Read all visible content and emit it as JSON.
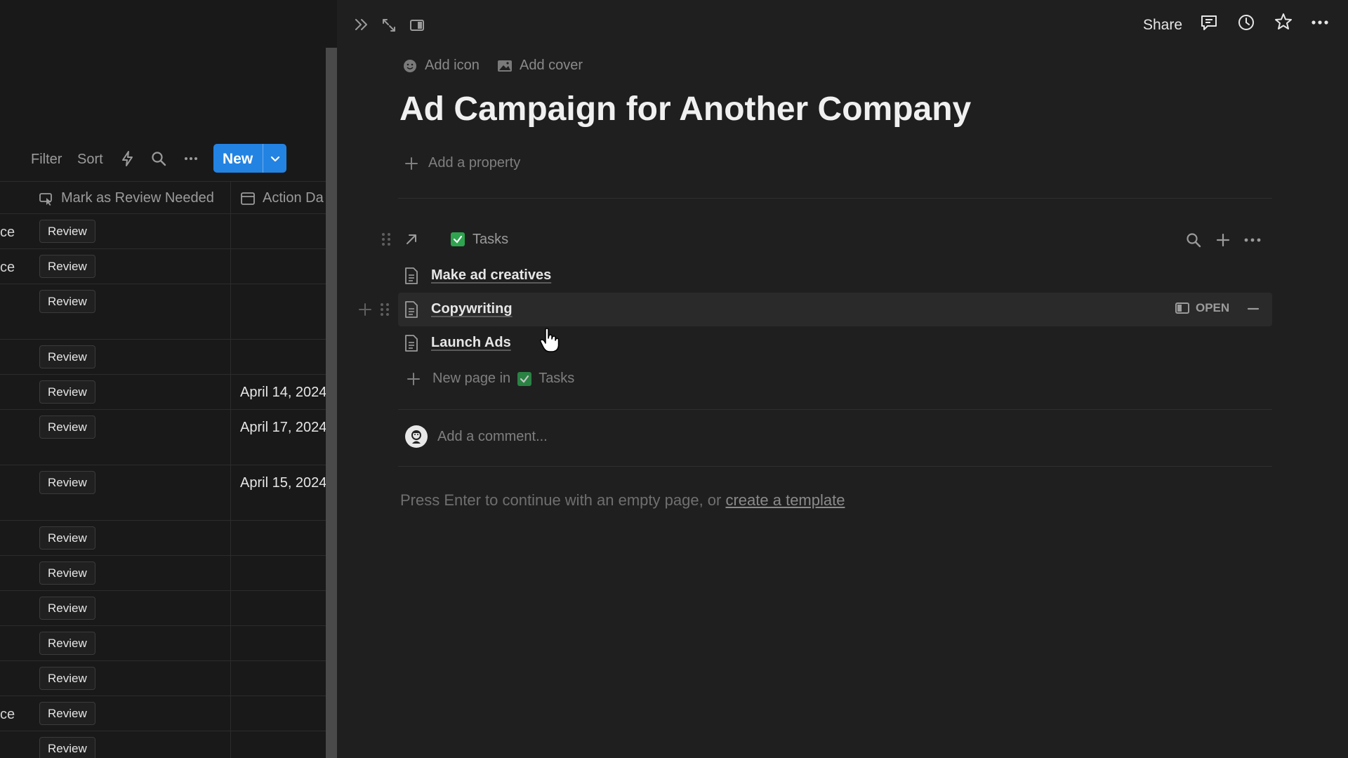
{
  "toolbar": {
    "filter_label": "Filter",
    "sort_label": "Sort",
    "new_label": "New"
  },
  "table": {
    "columns": [
      {
        "label": "Mark as Review Needed",
        "icon": "button-cursor-icon"
      },
      {
        "label": "Action Da",
        "icon": "calendar-icon"
      }
    ],
    "rows": [
      {
        "prefix": "ce",
        "button": "Review",
        "date": ""
      },
      {
        "prefix": "ce",
        "button": "Review",
        "date": ""
      },
      {
        "prefix": "",
        "button": "Review",
        "date": ""
      },
      {
        "prefix": "",
        "button": "Review",
        "date": ""
      },
      {
        "prefix": "",
        "button": "Review",
        "date": "April 14, 2024"
      },
      {
        "prefix": "",
        "button": "Review",
        "date": "April 17, 2024"
      },
      {
        "prefix": "",
        "button": "Review",
        "date": "April 15, 2024"
      },
      {
        "prefix": "",
        "button": "Review",
        "date": ""
      },
      {
        "prefix": "",
        "button": "Review",
        "date": ""
      },
      {
        "prefix": "",
        "button": "Review",
        "date": ""
      },
      {
        "prefix": "",
        "button": "Review",
        "date": ""
      },
      {
        "prefix": "",
        "button": "Review",
        "date": ""
      },
      {
        "prefix": "ce",
        "button": "Review",
        "date": ""
      },
      {
        "prefix": "",
        "button": "Review",
        "date": ""
      }
    ]
  },
  "peek": {
    "share_label": "Share",
    "add_icon_label": "Add icon",
    "add_cover_label": "Add cover",
    "title": "Ad Campaign for Another Company",
    "add_property_label": "Add a property",
    "linked_db": {
      "title": "Tasks",
      "items": [
        "Make ad creatives",
        "Copywriting",
        "Launch Ads"
      ],
      "open_label": "OPEN",
      "new_page_prefix": "New page in",
      "new_page_db": "Tasks"
    },
    "comment_placeholder": "Add a comment...",
    "hint_text": "Press Enter to continue with an empty page, or ",
    "hint_link": "create a template"
  },
  "colors": {
    "accent": "#2383e2",
    "check_green": "#2ea44f",
    "background": "#191919",
    "peek_background": "#1f1f1f"
  }
}
